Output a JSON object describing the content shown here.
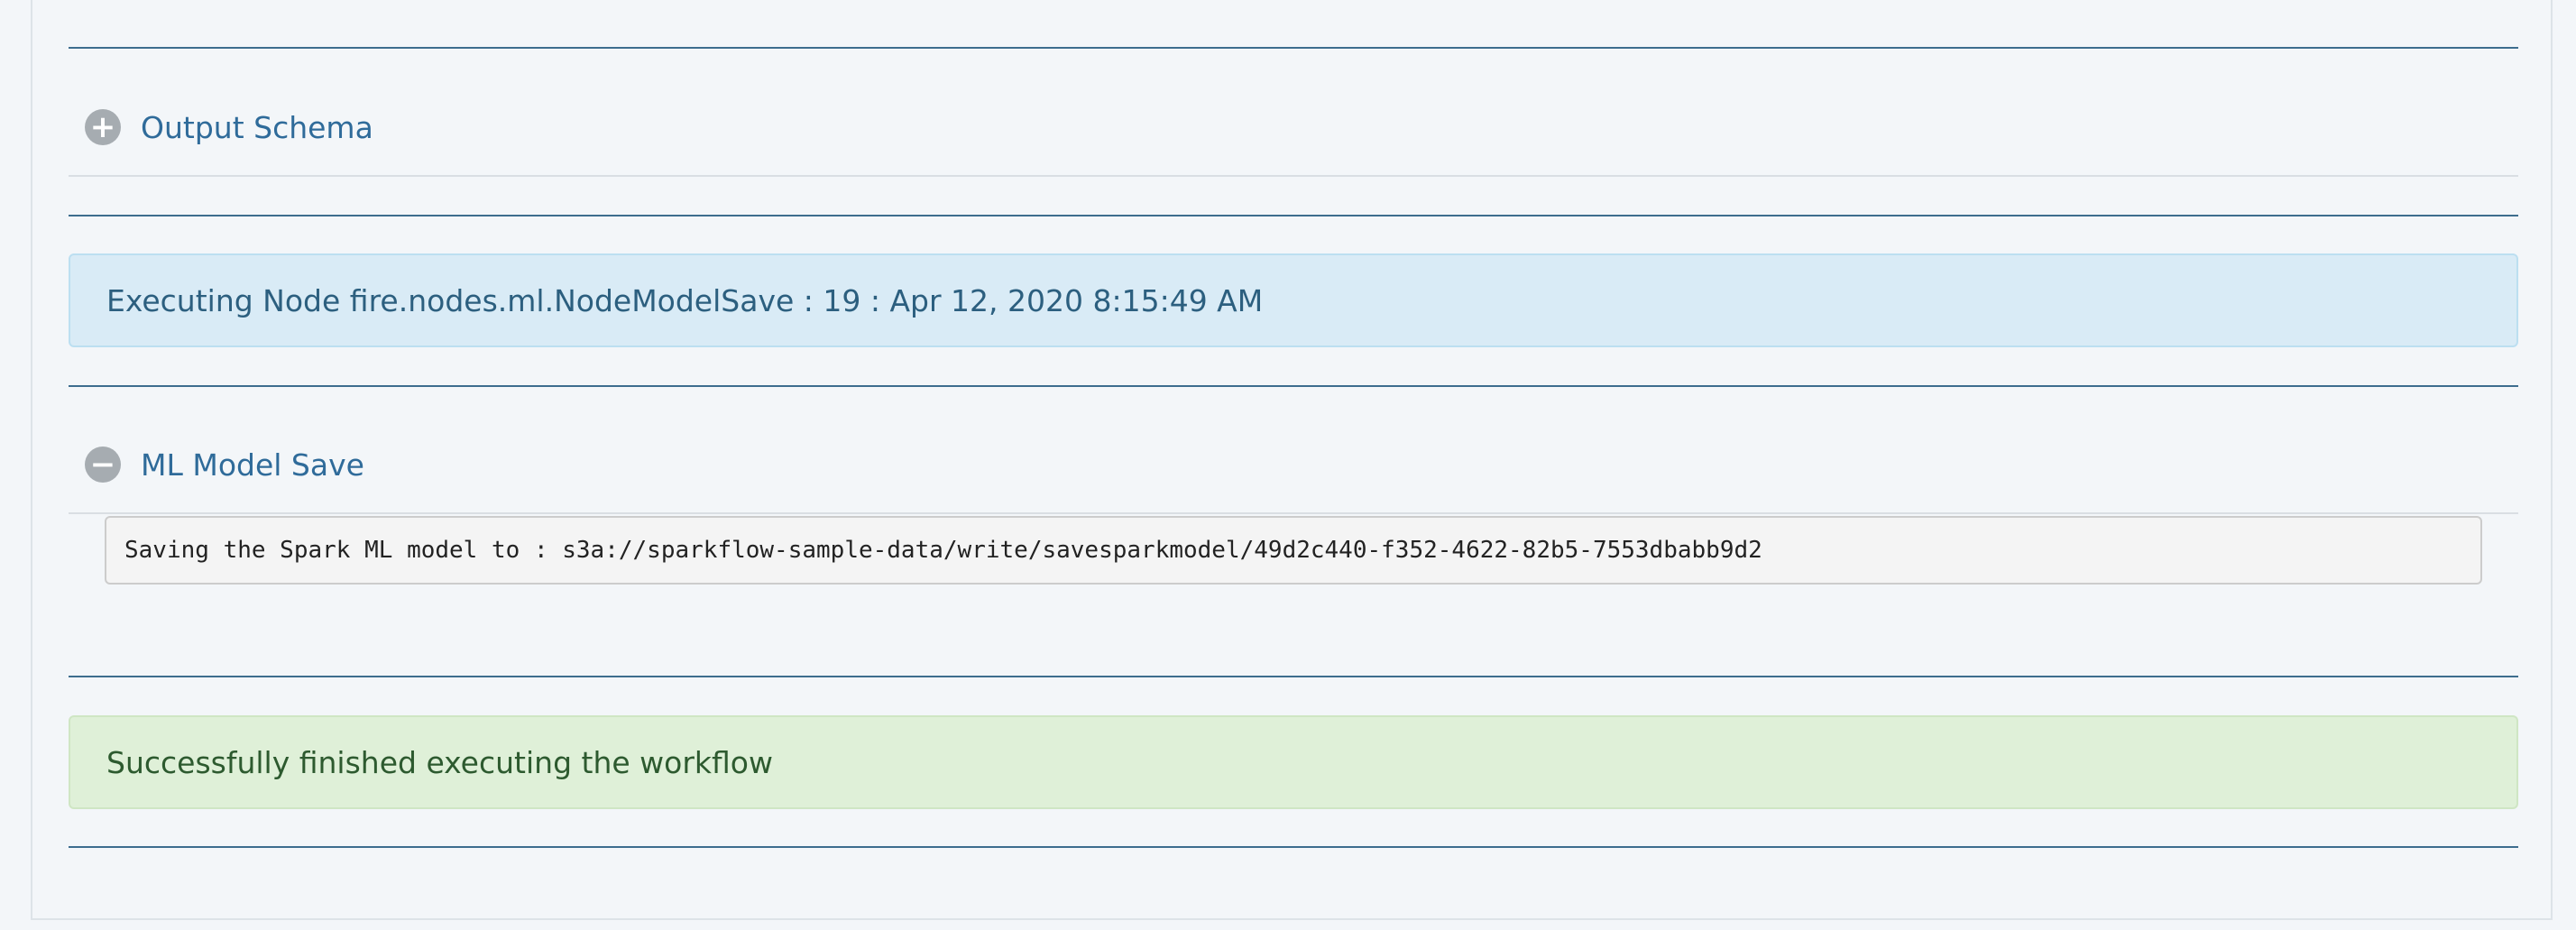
{
  "sections": {
    "output_schema": {
      "icon": "plus-circle-icon",
      "title": "Output Schema",
      "expanded": false
    },
    "ml_model_save": {
      "icon": "minus-circle-icon",
      "title": "ML Model Save",
      "expanded": true,
      "output": "Saving the Spark ML model to : s3a://sparkflow-sample-data/write/savesparkmodel/49d2c440-f352-4622-82b5-7553dbabb9d2"
    }
  },
  "messages": {
    "executing": "Executing Node fire.nodes.ml.NodeModelSave : 19 : Apr 12, 2020 8:15:49 AM",
    "success": "Successfully finished executing the workflow"
  },
  "icons": {
    "plus": "+",
    "minus": "−"
  },
  "colors": {
    "info_bg": "#d9ebf6",
    "success_bg": "#dff0d8",
    "link": "#2f6b9a",
    "rule": "#3d6d8e"
  }
}
